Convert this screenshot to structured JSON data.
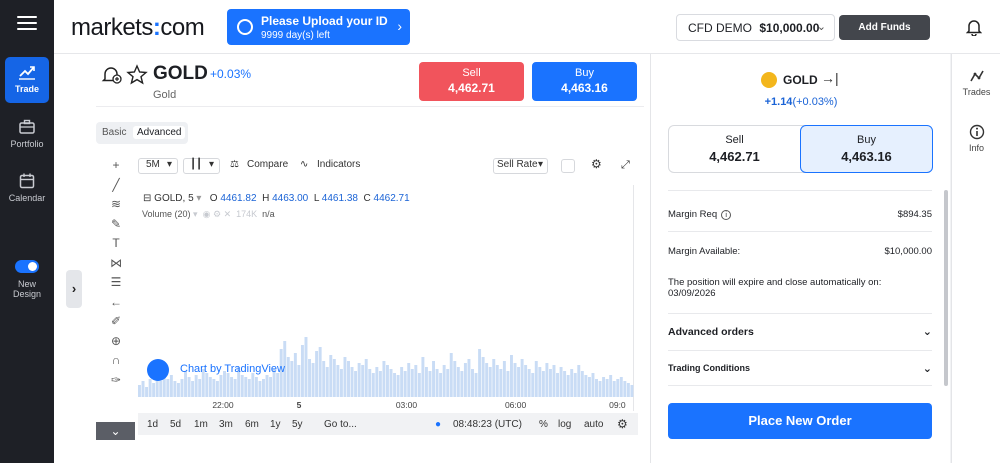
{
  "nav": {
    "items": [
      {
        "label": "Trade",
        "icon": "chart-line-icon",
        "active": true
      },
      {
        "label": "Portfolio",
        "icon": "briefcase-icon"
      },
      {
        "label": "Calendar",
        "icon": "calendar-icon"
      }
    ],
    "new_design": {
      "label_line1": "New",
      "label_line2": "Design",
      "enabled": true
    }
  },
  "header": {
    "logo_left": "markets",
    "logo_right": "com",
    "upload_title": "Please Upload your ID",
    "upload_sub": "9999 day(s) left",
    "account_label": "CFD DEMO",
    "account_balance": "$10,000.00",
    "add_funds": "Add Funds"
  },
  "asset": {
    "name": "GOLD",
    "change": "+0.03%",
    "subtitle": "Gold",
    "sell_label": "Sell",
    "sell_price": "4,462.71",
    "buy_label": "Buy",
    "buy_price": "4,463.16"
  },
  "chart_tabs": {
    "basic": "Basic",
    "advanced": "Advanced"
  },
  "chart_toolbar": {
    "interval": "5M",
    "compare": "Compare",
    "indicators": "Indicators",
    "rate": "Sell Rate"
  },
  "legend": {
    "symbol": "GOLD, 5",
    "o_label": "O",
    "o": "4461.82",
    "h_label": "H",
    "h": "4463.00",
    "l_label": "L",
    "l": "4461.38",
    "c_label": "C",
    "c": "4462.71",
    "volume_label": "Volume (20)",
    "volume_value": "174K",
    "volume_na": "n/a"
  },
  "tv_badge": "Chart by TradingView",
  "chart_data": {
    "type": "bar",
    "title": "",
    "x_ticks": [
      "22:00",
      "5",
      "03:00",
      "06:00",
      "09:0"
    ],
    "series": [
      {
        "values": [
          6,
          8,
          5,
          9,
          7,
          10,
          8,
          12,
          9,
          11,
          8,
          7,
          9,
          13,
          10,
          8,
          11,
          9,
          14,
          12,
          10,
          9,
          8,
          11,
          13,
          12,
          10,
          9,
          15,
          11,
          10,
          9,
          12,
          10,
          8,
          9,
          11,
          10,
          14,
          12,
          24,
          28,
          20,
          18,
          22,
          16,
          26,
          30,
          19,
          17,
          23,
          25,
          18,
          15,
          21,
          19,
          16,
          14,
          20,
          18,
          15,
          13,
          17,
          16,
          19,
          14,
          12,
          15,
          13,
          18,
          16,
          14,
          12,
          11,
          15,
          13,
          17,
          14,
          16,
          12,
          20,
          15,
          13,
          18,
          14,
          12,
          16,
          14,
          22,
          18,
          15,
          13,
          17,
          19,
          14,
          12,
          24,
          20,
          17,
          15,
          19,
          16,
          14,
          18,
          13,
          21,
          17,
          15,
          19,
          16,
          14,
          12,
          18,
          15,
          13,
          17,
          14,
          16,
          12,
          15,
          13,
          11,
          14,
          12,
          16,
          13,
          11,
          10,
          12,
          9,
          8,
          10,
          9,
          11,
          8,
          9,
          10,
          8,
          7,
          6
        ]
      }
    ]
  },
  "bottom_bar": {
    "ranges": [
      "1d",
      "5d",
      "1m",
      "3m",
      "6m",
      "1y",
      "5y"
    ],
    "goto": "Go to...",
    "time": "08:48:23 (UTC)",
    "pct": "%",
    "log": "log",
    "auto": "auto"
  },
  "order": {
    "name": "GOLD",
    "change_abs": "+1.14",
    "change_pct": "(+0.03%)",
    "sell_label": "Sell",
    "sell_price": "4,462.71",
    "buy_label": "Buy",
    "buy_price": "4,463.16",
    "margin_req_label": "Margin Req",
    "margin_req": "$894.35",
    "margin_avail_label": "Margin Available:",
    "margin_avail": "$10,000.00",
    "expire_text": "The position will expire and close automatically on: 03/09/2026",
    "advanced_orders": "Advanced orders",
    "trading_conditions": "Trading Conditions",
    "place_order": "Place New Order"
  },
  "right_tools": [
    {
      "label": "Trades",
      "icon": "trades-icon"
    },
    {
      "label": "Info",
      "icon": "info-icon"
    }
  ],
  "colors": {
    "accent": "#1a73ff",
    "sell": "#f1545c",
    "rail": "#1e2026"
  }
}
